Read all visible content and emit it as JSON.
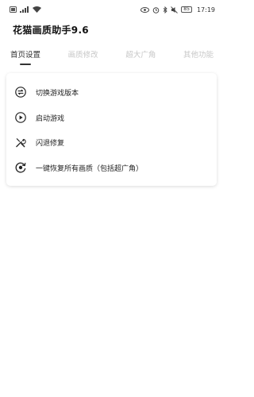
{
  "status_bar": {
    "left_icons": [
      "sim-icon",
      "signal-icon",
      "wifi-icon"
    ],
    "right_icons": [
      "eye-icon",
      "alarm-icon",
      "bluetooth-icon",
      "mute-icon"
    ],
    "battery": "85",
    "time": "17:19"
  },
  "app": {
    "title": "花猫画质助手9.6"
  },
  "tabs": [
    {
      "label": "首页设置",
      "active": true
    },
    {
      "label": "画质修改",
      "active": false
    },
    {
      "label": "超大广角",
      "active": false
    },
    {
      "label": "其他功能",
      "active": false
    }
  ],
  "menu": {
    "items": [
      {
        "label": "切换游戏版本",
        "icon": "swap-icon"
      },
      {
        "label": "启动游戏",
        "icon": "play-icon"
      },
      {
        "label": "闪退修复",
        "icon": "wrench-icon"
      },
      {
        "label": "一键恢复所有画质（包括超广角）",
        "icon": "restore-icon"
      }
    ]
  },
  "colors": {
    "active_tab": "#333333",
    "inactive_tab": "#c8c8c8",
    "card_bg": "#ffffff"
  }
}
